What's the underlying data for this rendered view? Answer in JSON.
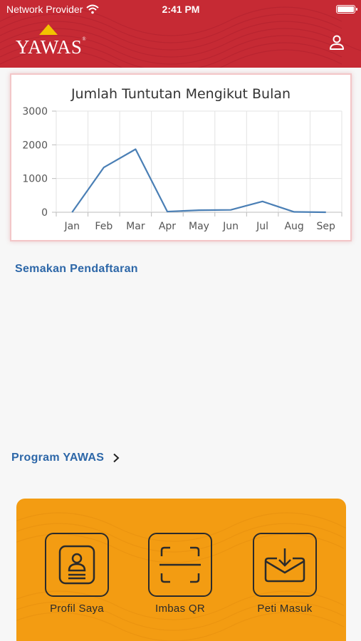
{
  "status_bar": {
    "carrier": "Network Provider",
    "time": "2:41 PM",
    "wifi_icon": "wifi-icon",
    "battery_icon": "battery-icon"
  },
  "header": {
    "logo_text": "YAWAS",
    "logo_mark": "®",
    "background_color": "#c62a34",
    "profile_icon": "user-icon"
  },
  "chart_data": {
    "type": "line",
    "title": "Jumlah Tuntutan Mengikut Bulan",
    "categories": [
      "Jan",
      "Feb",
      "Mar",
      "Apr",
      "May",
      "Jun",
      "Jul",
      "Aug",
      "Sep"
    ],
    "values": [
      0,
      1330,
      1870,
      20,
      60,
      70,
      320,
      10,
      0
    ],
    "ylim": [
      0,
      3000
    ],
    "yticks": [
      "0",
      "1000",
      "2000",
      "3000"
    ],
    "xlabel": "",
    "ylabel": "",
    "grid": true,
    "line_color": "#4a7fb5"
  },
  "links": {
    "semakan": "Semakan Pendaftaran",
    "program": "Program YAWAS"
  },
  "actions": {
    "card_color": "#f39c12",
    "items": [
      {
        "label": "Profil Saya",
        "icon": "profile-card-icon"
      },
      {
        "label": "Imbas QR",
        "icon": "qr-scan-icon"
      },
      {
        "label": "Peti Masuk",
        "icon": "inbox-icon"
      }
    ]
  }
}
